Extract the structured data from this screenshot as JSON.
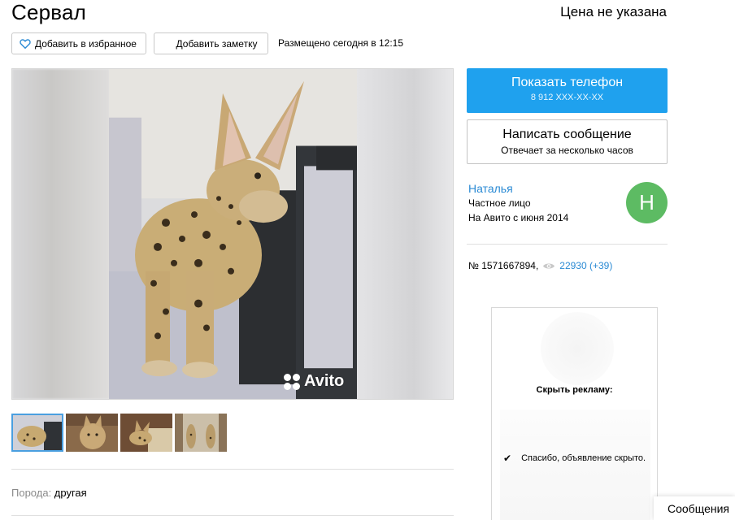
{
  "listing": {
    "title": "Сервал",
    "price": "Цена не указана",
    "posted": "Размещено сегодня в 12:15",
    "id_text": "№ 1571667894,",
    "views_text": "22930 (+39)"
  },
  "actions": {
    "favorite_label": "Добавить в избранное",
    "note_label": "Добавить заметку"
  },
  "gallery": {
    "watermark": "Avito",
    "thumbnail_count": 4,
    "active_thumbnail": 1
  },
  "params": {
    "breed_label": "Порода: ",
    "breed_value": "другая"
  },
  "contact": {
    "phone_label": "Показать телефон",
    "phone_masked": "8 912 XXX-XX-XX",
    "message_label": "Написать сообщение",
    "message_sub": "Отвечает за несколько часов"
  },
  "seller": {
    "name": "Наталья",
    "type": "Частное лицо",
    "since": "На Авито с июня 2014",
    "avatar_letter": "Н",
    "avatar_color": "#5dbb63"
  },
  "ad_block": {
    "hide_title": "Скрыть рекламу:",
    "hidden_confirm": "Спасибо, объявление скрыто."
  },
  "chat": {
    "label": "Сообщения"
  },
  "colors": {
    "accent_blue": "#1fa1ee",
    "link_blue": "#2a8ad4"
  },
  "icons": [
    "heart-icon",
    "eye-icon",
    "check-icon",
    "avito-logo-icon"
  ]
}
